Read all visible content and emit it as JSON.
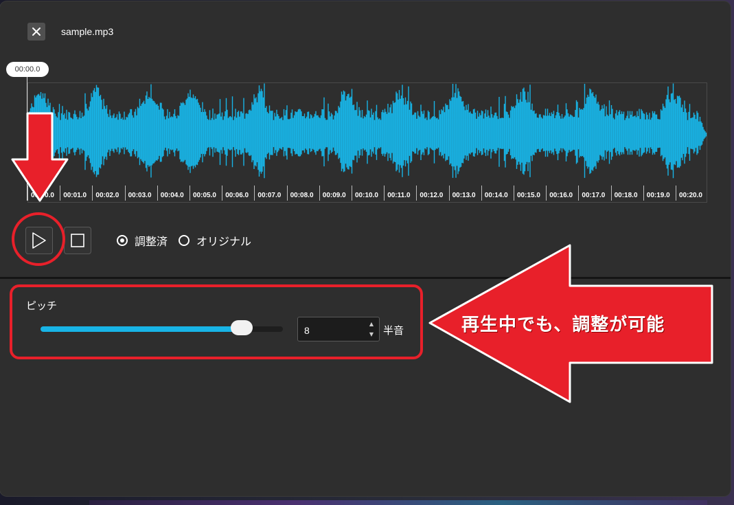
{
  "window": {
    "file_name": "sample.mp3",
    "close_icon": "close-icon"
  },
  "player": {
    "current_time": "00:00.0",
    "waveform_color": "#18b4e6",
    "timeline_ticks": [
      "00:00.0",
      "00:01.0",
      "00:02.0",
      "00:03.0",
      "00:04.0",
      "00:05.0",
      "00:06.0",
      "00:07.0",
      "00:08.0",
      "00:09.0",
      "00:10.0",
      "00:11.0",
      "00:12.0",
      "00:13.0",
      "00:14.0",
      "00:15.0",
      "00:16.0",
      "00:17.0",
      "00:18.0",
      "00:19.0",
      "00:20.0"
    ],
    "play_icon": "play-icon",
    "stop_icon": "stop-icon"
  },
  "mode": {
    "options": [
      {
        "label": "調整済",
        "checked": true
      },
      {
        "label": "オリジナル",
        "checked": false
      }
    ]
  },
  "pitch": {
    "label": "ピッチ",
    "value": "8",
    "unit": "半音",
    "slider_fraction": 0.83
  },
  "annotation": {
    "callout": "再生中でも、調整が可能",
    "highlight_color": "#e8202a"
  }
}
